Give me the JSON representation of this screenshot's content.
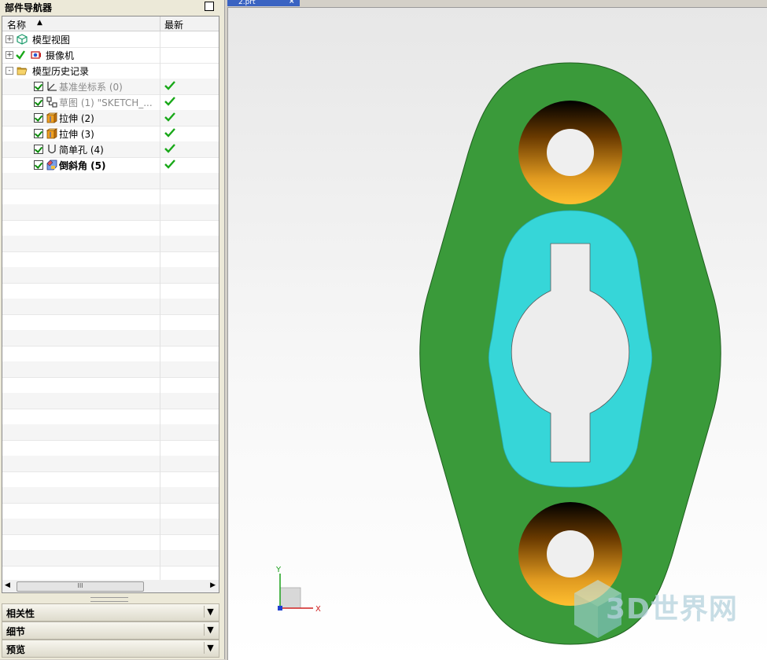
{
  "navigator": {
    "title": "部件导航器",
    "columns": {
      "name": "名称",
      "latest": "最新"
    },
    "tree": [
      {
        "label": "模型视图",
        "level": 0,
        "expander": "+",
        "state": "normal"
      },
      {
        "label": "摄像机",
        "level": 0,
        "expander": "+",
        "state": "normal"
      },
      {
        "label": "模型历史记录",
        "level": 0,
        "expander": "-",
        "state": "normal"
      },
      {
        "label": "基准坐标系 (0)",
        "level": 1,
        "state": "gray",
        "latest": true
      },
      {
        "label": "草图 (1) \"SKETCH_...",
        "level": 1,
        "state": "gray",
        "latest": true
      },
      {
        "label": "拉伸 (2)",
        "level": 1,
        "state": "normal",
        "latest": true
      },
      {
        "label": "拉伸 (3)",
        "level": 1,
        "state": "normal",
        "latest": true
      },
      {
        "label": "简单孔 (4)",
        "level": 1,
        "state": "normal",
        "latest": true
      },
      {
        "label": "倒斜角 (5)",
        "level": 1,
        "state": "bold",
        "latest": true
      }
    ],
    "icons": [
      "model-views-icon",
      "camera-icon",
      "folder-open-icon",
      "datum-csys-icon",
      "sketch-icon",
      "extrude-icon",
      "extrude-icon",
      "simple-hole-icon",
      "chamfer-icon"
    ],
    "scrollbar_thumb": "III"
  },
  "sections": [
    {
      "label": "相关性"
    },
    {
      "label": "细节"
    },
    {
      "label": "预览"
    }
  ],
  "graphics": {
    "tab_label": "2.prt",
    "axis_y": "Y",
    "axis_x": "X",
    "watermark": "3D世界网",
    "colors": {
      "plate": "#3a9a3a",
      "pocket": "#36d6d8",
      "counterbore": "#e0a020",
      "background": "#eeeeee"
    }
  }
}
